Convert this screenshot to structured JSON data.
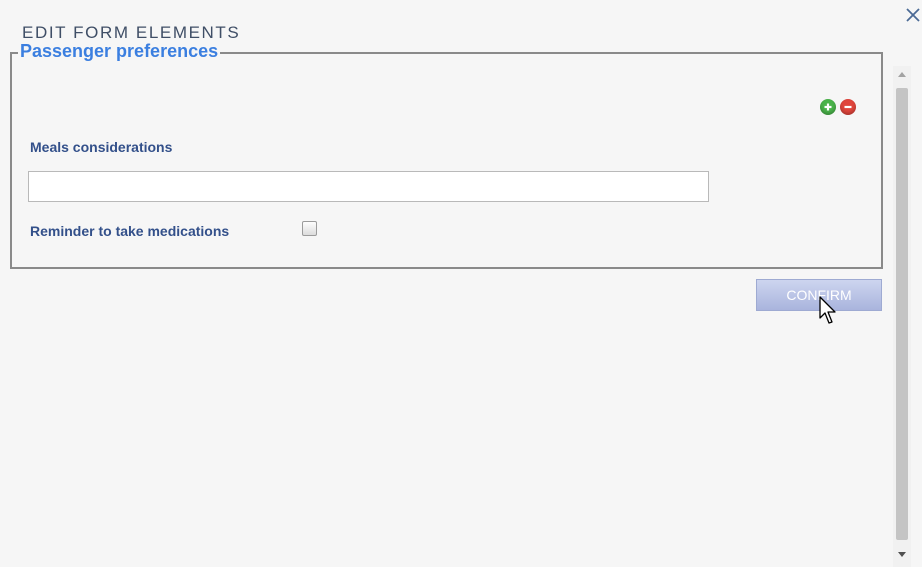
{
  "dialog": {
    "title": "EDIT FORM ELEMENTS",
    "close_icon": "close-icon"
  },
  "fieldset": {
    "legend": "Passenger preferences",
    "add_icon": "plus-icon",
    "remove_icon": "minus-icon",
    "meals": {
      "label": "Meals considerations",
      "value": "",
      "placeholder": ""
    },
    "reminder": {
      "label": "Reminder to take medications",
      "checked": false
    }
  },
  "actions": {
    "confirm_label": "CONFIRM"
  },
  "colors": {
    "title": "#3f4e66",
    "legend": "#3b7fe0",
    "label": "#33508a",
    "add": "#4ab34a",
    "remove": "#e0453c",
    "confirm_bg": "#b9c3e6"
  }
}
